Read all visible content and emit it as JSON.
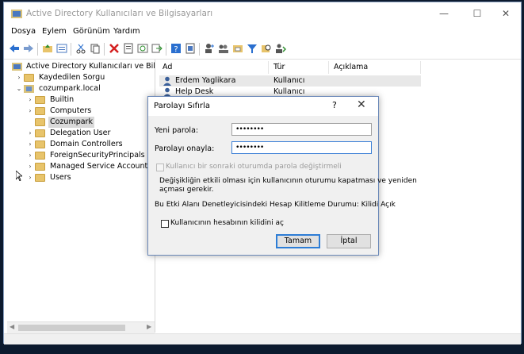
{
  "window": {
    "title": "Active Directory Kullanıcıları ve Bilgisayarları",
    "controls": {
      "minimize": "—",
      "maximize": "☐",
      "close": "✕"
    }
  },
  "menu": [
    "Dosya",
    "Eylem",
    "Görünüm",
    "Yardım"
  ],
  "toolbar_icons": [
    "back-icon",
    "forward-icon",
    "folder-up-icon",
    "details-view-icon",
    "cut-icon",
    "copy-icon",
    "delete-icon",
    "properties-icon",
    "refresh-icon",
    "export-icon",
    "help-icon",
    "help-doc-icon",
    "add-user-icon",
    "add-group-icon",
    "add-ou-icon",
    "filter-icon",
    "find-icon",
    "add-to-group-icon"
  ],
  "tree": {
    "root": "Active Directory Kullanıcıları ve Bilgisaya",
    "saved_queries": "Kaydedilen Sorgu",
    "domain": "cozumpark.local",
    "children": [
      "Builtin",
      "Computers",
      "Cozumpark",
      "Delegation User",
      "Domain Controllers",
      "ForeignSecurityPrincipals",
      "Managed Service Accounts",
      "Users"
    ],
    "selected": "Cozumpark"
  },
  "list": {
    "columns": {
      "name": "Ad",
      "type": "Tür",
      "desc": "Açıklama"
    },
    "rows": [
      {
        "name": "Erdem Yaglikara",
        "type": "Kullanıcı"
      },
      {
        "name": "Help Desk",
        "type": "Kullanıcı"
      }
    ]
  },
  "dialog": {
    "title": "Parolayı Sıfırla",
    "help": "?",
    "close": "✕",
    "new_password_label": "Yeni parola:",
    "new_password_value": "••••••••",
    "confirm_label": "Parolayı onayla:",
    "confirm_value": "••••••••",
    "must_change_label": "Kullanıcı bir sonraki oturumda parola değiştirmeli",
    "info_line1": "Değişikliğin etkili olması için kullanıcının oturumu kapatması ve yeniden",
    "info_line2": "açması gerekir.",
    "lockout_status": "Bu Etki Alanı Denetleyicisindeki Hesap Kilitleme Durumu: Kilidi Açık",
    "unlock_label": "Kullanıcının hesabının kilidini aç",
    "ok": "Tamam",
    "cancel": "İptal"
  }
}
